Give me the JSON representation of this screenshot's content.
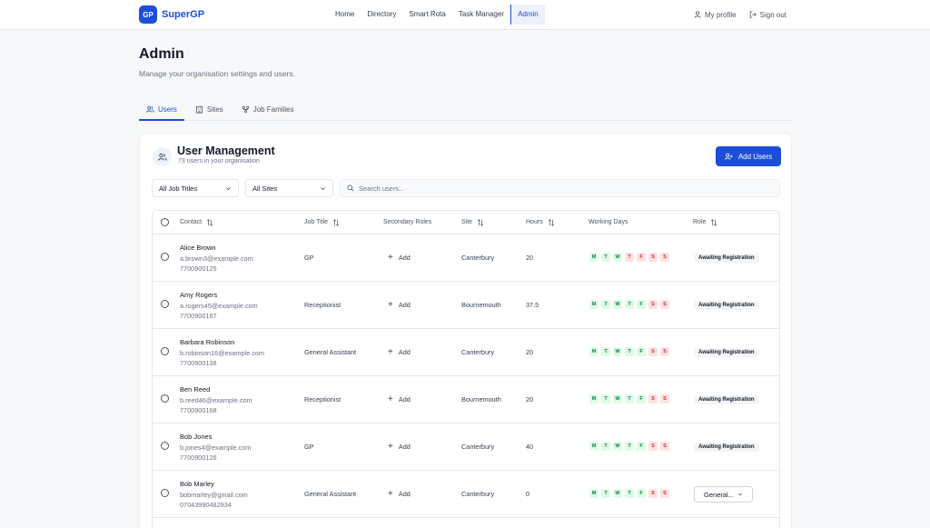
{
  "app": {
    "logo_badge": "GP",
    "name": "SuperGP",
    "brand_color": "#1d4ed8"
  },
  "nav": {
    "items": [
      "Home",
      "Directory",
      "Smart Rota",
      "Task Manager",
      "Admin"
    ],
    "active": "Admin",
    "profile": "My profile",
    "signout": "Sign out"
  },
  "page": {
    "title": "Admin",
    "subtitle": "Manage your organisation settings and users."
  },
  "tabs": [
    "Users",
    "Sites",
    "Job Families"
  ],
  "card": {
    "title": "User Management",
    "subtitle": "73 users in your organisation",
    "add_button": "Add Users"
  },
  "filters": {
    "job_titles": "All Job Titles",
    "sites": "All Sites",
    "search_placeholder": "Search users..."
  },
  "columns": [
    "Contact",
    "Job Title",
    "Secondary Roles",
    "Site",
    "Hours",
    "Working Days",
    "Role"
  ],
  "add_label": "Add",
  "day_letters": [
    "M",
    "T",
    "W",
    "T",
    "F",
    "S",
    "S"
  ],
  "rows": [
    {
      "name": "Alice Brown",
      "email": "a.brown3@example.com",
      "phone": "7700900125",
      "job_title": "GP",
      "site": "Canterbury",
      "hours": "20",
      "days": [
        1,
        1,
        1,
        0,
        0,
        0,
        0
      ],
      "role": "Awaiting Registration"
    },
    {
      "name": "Amy Rogers",
      "email": "a.rogers45@example.com",
      "phone": "7700900167",
      "job_title": "Receptionist",
      "site": "Bournemouth",
      "hours": "37.5",
      "days": [
        1,
        1,
        1,
        1,
        1,
        0,
        0
      ],
      "role": "Awaiting Registration"
    },
    {
      "name": "Barbara Robinson",
      "email": "b.robinson16@example.com",
      "phone": "7700900138",
      "job_title": "General Assistant",
      "site": "Canterbury",
      "hours": "20",
      "days": [
        1,
        1,
        1,
        1,
        1,
        0,
        0
      ],
      "role": "Awaiting Registration"
    },
    {
      "name": "Ben Reed",
      "email": "b.reed46@example.com",
      "phone": "7700900168",
      "job_title": "Receptionist",
      "site": "Bournemouth",
      "hours": "20",
      "days": [
        1,
        1,
        1,
        1,
        1,
        0,
        0
      ],
      "role": "Awaiting Registration"
    },
    {
      "name": "Bob Jones",
      "email": "b.jones4@example.com",
      "phone": "7700900126",
      "job_title": "GP",
      "site": "Canterbury",
      "hours": "40",
      "days": [
        1,
        1,
        1,
        1,
        1,
        0,
        0
      ],
      "role": "Awaiting Registration"
    },
    {
      "name": "Bob Marley",
      "email": "bobmarley@gmail.com",
      "phone": "07043990482934",
      "job_title": "General Assistant",
      "site": "Canterbury",
      "hours": "0",
      "days": [
        1,
        1,
        1,
        1,
        1,
        0,
        0
      ],
      "role": "General..."
    }
  ],
  "colors": {
    "day_on_bg": "#dcfce7",
    "day_on_text": "#15803d",
    "day_off_bg": "#fee2e2",
    "day_off_text": "#dc2626"
  }
}
